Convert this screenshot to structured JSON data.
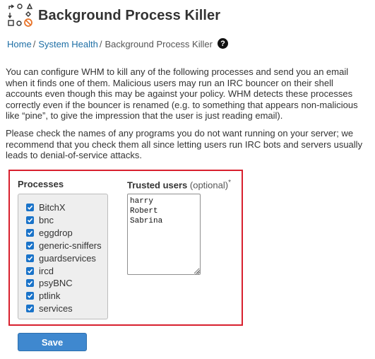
{
  "page": {
    "title": "Background Process Killer",
    "logo_icon": "background-process-killer-icon"
  },
  "breadcrumb": {
    "items": [
      "Home",
      "System Health"
    ],
    "separator": "/",
    "current": "Background Process Killer",
    "help_icon": "question-circle-icon"
  },
  "description": {
    "paragraph1": "You can configure WHM to kill any of the following processes and send you an email when it finds one of them. Malicious users may run an IRC bouncer on their shell accounts even though this may be against your policy. WHM detects these processes correctly even if the bouncer is renamed (e.g. to something that appears non-malicious like “pine”, to give the impression that the user is just reading email).",
    "paragraph2": "Please check the names of any programs you do not want running on your server; we recommend that you check them all since letting users run IRC bots and servers usually leads to denial-of-service attacks."
  },
  "form": {
    "processes_label": "Processes",
    "processes": [
      {
        "name": "BitchX",
        "checked": true
      },
      {
        "name": "bnc",
        "checked": true
      },
      {
        "name": "eggdrop",
        "checked": true
      },
      {
        "name": "generic-sniffers",
        "checked": true
      },
      {
        "name": "guardservices",
        "checked": true
      },
      {
        "name": "ircd",
        "checked": true
      },
      {
        "name": "psyBNC",
        "checked": true
      },
      {
        "name": "ptlink",
        "checked": true
      },
      {
        "name": "services",
        "checked": true
      }
    ],
    "trusted_label": "Trusted users",
    "trusted_optional": "(optional)",
    "trusted_marker": "*",
    "trusted_value": "harry\nRobert\nSabrina",
    "save_label": "Save"
  },
  "colors": {
    "link": "#1d6ea5",
    "highlight_border": "#d8202e",
    "checkbox": "#1a73c9",
    "button": "#3f88cf"
  }
}
